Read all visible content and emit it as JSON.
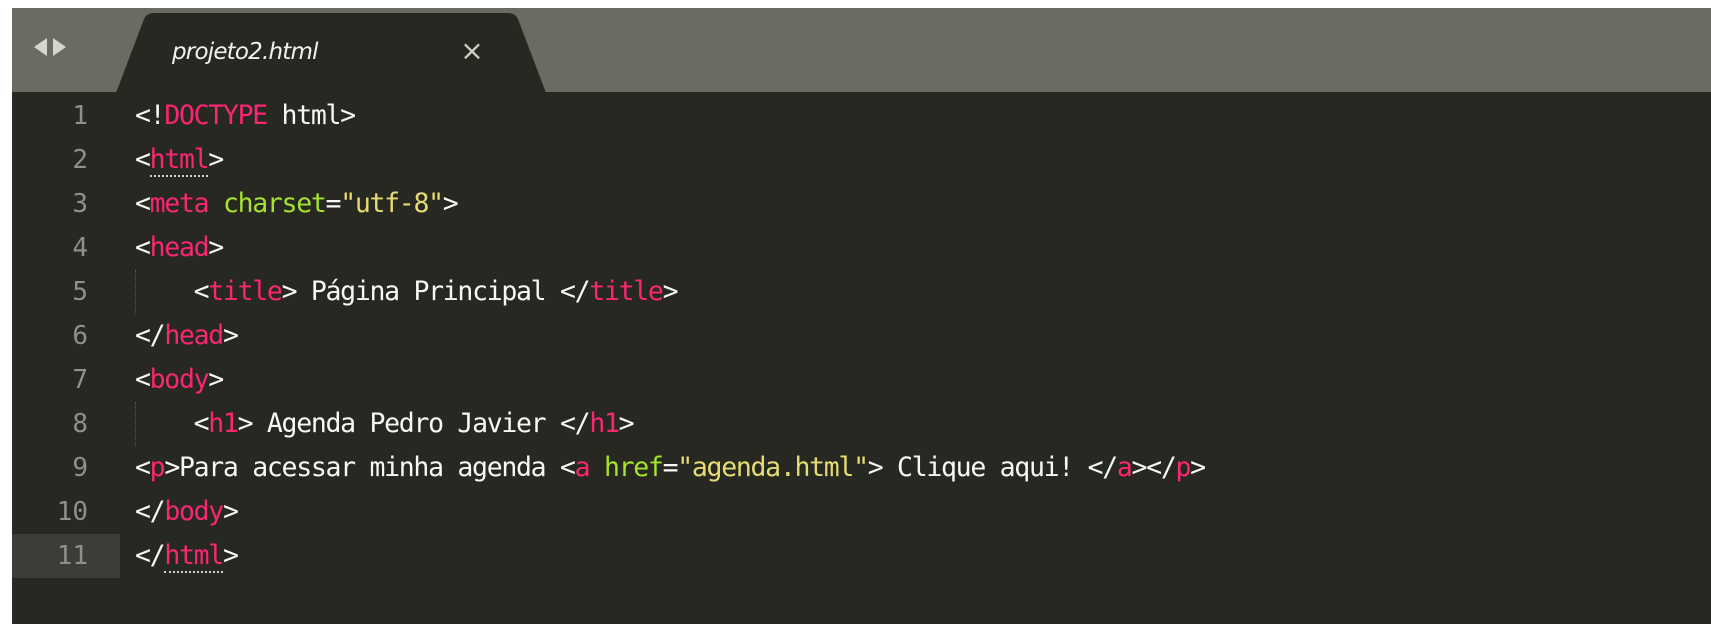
{
  "tab": {
    "filename": "projeto2.html",
    "close_glyph": "×"
  },
  "icons": {
    "nav_left": "triangle-left",
    "nav_right": "triangle-right"
  },
  "colors": {
    "background": "#272822",
    "tabbar": "#6b6b63",
    "tag": "#f92672",
    "attribute": "#a6e22e",
    "string": "#e6db74",
    "text": "#f8f8f2",
    "gutter": "#90908a"
  },
  "editor": {
    "current_line": 11,
    "lines": [
      {
        "num": "1",
        "tokens": [
          [
            "p",
            "<!"
          ],
          [
            "t",
            "DOCTYPE"
          ],
          [
            "p",
            " html>"
          ]
        ]
      },
      {
        "num": "2",
        "tokens": [
          [
            "p",
            "<"
          ],
          [
            "t",
            "html",
            "match"
          ],
          [
            "p",
            ">"
          ]
        ]
      },
      {
        "num": "3",
        "tokens": [
          [
            "p",
            "<"
          ],
          [
            "t",
            "meta"
          ],
          [
            "p",
            " "
          ],
          [
            "a",
            "charset"
          ],
          [
            "p",
            "="
          ],
          [
            "s",
            "\"utf-8\""
          ],
          [
            "p",
            ">"
          ]
        ]
      },
      {
        "num": "4",
        "tokens": [
          [
            "p",
            "<"
          ],
          [
            "t",
            "head"
          ],
          [
            "p",
            ">"
          ]
        ]
      },
      {
        "num": "5",
        "tokens": [
          [
            "p",
            "    <"
          ],
          [
            "t",
            "title"
          ],
          [
            "p",
            "> Página Principal </"
          ],
          [
            "t",
            "title"
          ],
          [
            "p",
            ">"
          ]
        ]
      },
      {
        "num": "6",
        "tokens": [
          [
            "p",
            "</"
          ],
          [
            "t",
            "head"
          ],
          [
            "p",
            ">"
          ]
        ]
      },
      {
        "num": "7",
        "tokens": [
          [
            "p",
            "<"
          ],
          [
            "t",
            "body"
          ],
          [
            "p",
            ">"
          ]
        ]
      },
      {
        "num": "8",
        "tokens": [
          [
            "p",
            "    <"
          ],
          [
            "t",
            "h1"
          ],
          [
            "p",
            "> Agenda Pedro Javier </"
          ],
          [
            "t",
            "h1"
          ],
          [
            "p",
            ">"
          ]
        ]
      },
      {
        "num": "9",
        "tokens": [
          [
            "p",
            "<"
          ],
          [
            "t",
            "p"
          ],
          [
            "p",
            ">Para acessar minha agenda <"
          ],
          [
            "t",
            "a"
          ],
          [
            "p",
            " "
          ],
          [
            "a",
            "href"
          ],
          [
            "p",
            "="
          ],
          [
            "s",
            "\"agenda.html\""
          ],
          [
            "p",
            "> Clique aqui! </"
          ],
          [
            "t",
            "a"
          ],
          [
            "p",
            "></"
          ],
          [
            "t",
            "p"
          ],
          [
            "p",
            ">"
          ]
        ]
      },
      {
        "num": "10",
        "tokens": [
          [
            "p",
            "</"
          ],
          [
            "t",
            "body"
          ],
          [
            "p",
            ">"
          ]
        ]
      },
      {
        "num": "11",
        "tokens": [
          [
            "p",
            "</"
          ],
          [
            "t",
            "html",
            "match"
          ],
          [
            "p",
            ">"
          ]
        ]
      }
    ]
  }
}
